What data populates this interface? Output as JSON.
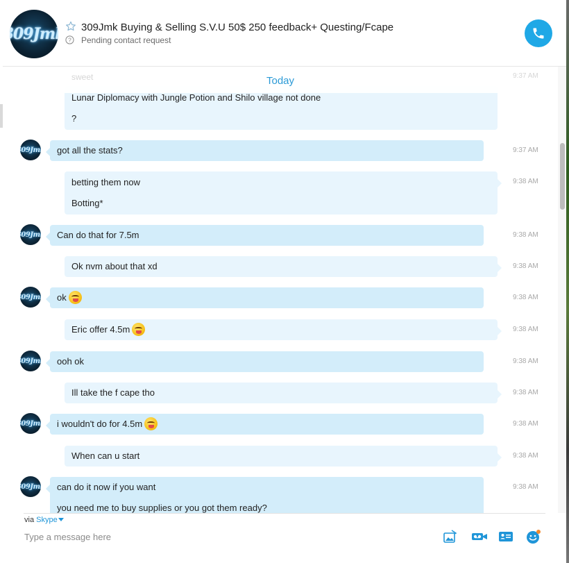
{
  "header": {
    "avatar_text": "309Jmk",
    "title": "309Jmk Buying & Selling S.V.U 50$ 250 feedback+ Questing/Fcape",
    "status": "Pending contact request"
  },
  "chat": {
    "date_divider": "Today",
    "ghost_text": "sweet",
    "ghost_time": "9:37 AM",
    "messages": [
      {
        "dir": "out",
        "lines": [
          "Lunar Diplomacy with Jungle Potion and Shilo village not done",
          "?"
        ],
        "time": ""
      },
      {
        "dir": "in",
        "lines": [
          "got all the stats?"
        ],
        "time": "9:37 AM"
      },
      {
        "dir": "out",
        "lines": [
          "betting them now",
          "Botting*"
        ],
        "time": "9:38 AM"
      },
      {
        "dir": "in",
        "lines": [
          "Can do that for 7.5m"
        ],
        "time": "9:38 AM"
      },
      {
        "dir": "out",
        "lines": [
          "Ok nvm about that xd"
        ],
        "time": "9:38 AM"
      },
      {
        "dir": "in",
        "lines": [
          "ok"
        ],
        "emoji": "savoring-face-emoji",
        "time": "9:38 AM"
      },
      {
        "dir": "out",
        "lines": [
          "Eric offer 4.5m"
        ],
        "emoji": "savoring-face-emoji",
        "time": "9:38 AM"
      },
      {
        "dir": "in",
        "lines": [
          "ooh ok"
        ],
        "time": "9:38 AM"
      },
      {
        "dir": "out",
        "lines": [
          "Ill take the f cape tho"
        ],
        "time": "9:38 AM"
      },
      {
        "dir": "in",
        "lines": [
          "i wouldn't do for 4.5m"
        ],
        "emoji": "savoring-face-emoji",
        "time": "9:38 AM"
      },
      {
        "dir": "out",
        "lines": [
          "When can u start"
        ],
        "time": "9:38 AM"
      },
      {
        "dir": "in",
        "lines": [
          "can do it now if you want",
          "you need me to buy supplies or you got them ready?"
        ],
        "time": "9:38 AM"
      }
    ]
  },
  "compose": {
    "via_label": "via",
    "via_service": "Skype",
    "placeholder": "Type a message here",
    "tools": [
      "send-media-icon",
      "video-message-icon",
      "send-contact-icon",
      "emoticon-icon"
    ]
  },
  "colors": {
    "accent": "#1fa8e6",
    "incoming_bubble": "#d3edfa",
    "outgoing_bubble": "#e8f5fd",
    "link": "#1f95d8"
  }
}
